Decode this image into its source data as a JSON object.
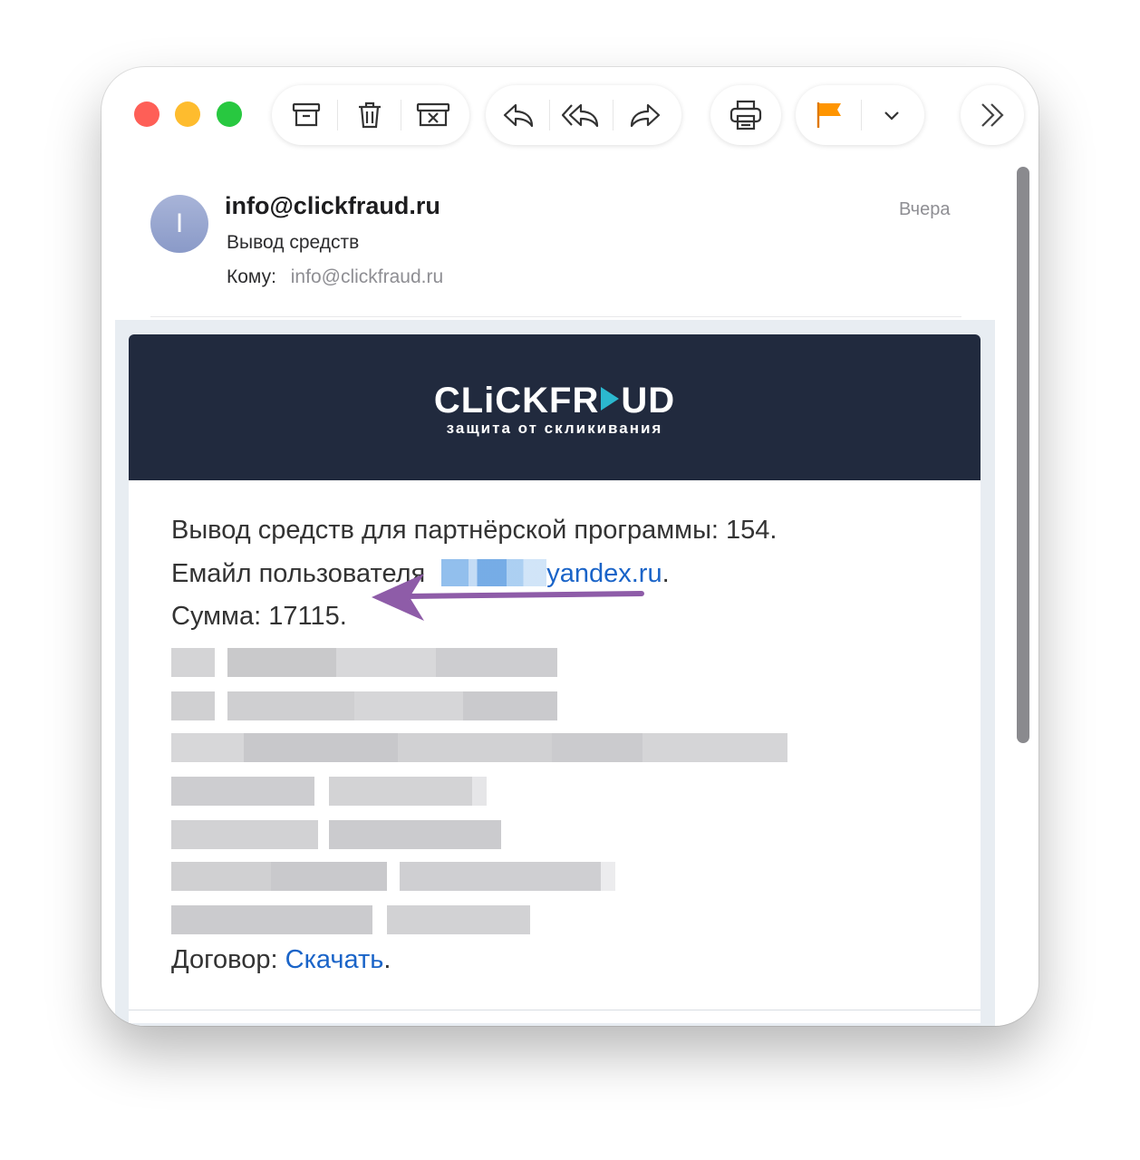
{
  "window": {
    "traffic_lights": [
      "close",
      "minimize",
      "zoom"
    ],
    "toolbar": {
      "archive": "archive-icon",
      "delete": "trash-icon",
      "junk": "junk-icon",
      "reply": "reply-icon",
      "reply_all": "reply-all-icon",
      "forward": "forward-icon",
      "print": "print-icon",
      "flag": "flag-icon",
      "flag_color": "#ff9500",
      "flag_menu": "chevron-down-icon",
      "more": "chevron-double-right-icon"
    }
  },
  "message": {
    "avatar_initial": "I",
    "sender": "info@clickfraud.ru",
    "subject": "Вывод средств",
    "to_label": "Кому:",
    "to_value": "info@clickfraud.ru",
    "date": "Вчера"
  },
  "email": {
    "logo_left": "CLiCKFR",
    "logo_right": "UD",
    "logo_tagline": "защита от скликивания",
    "line1": "Вывод средств для партнёрской программы: 154.",
    "line2_label": "Емайл пользователя",
    "line2_email": "yandex.ru",
    "line2_end": ".",
    "line3": "Сумма: 17115.",
    "contract_label": "Договор:",
    "contract_link": "Скачать",
    "contract_end": ".",
    "colors": {
      "banner": "#212a3e",
      "link": "#1a64c8",
      "arrow": "#8e5ca8"
    }
  }
}
